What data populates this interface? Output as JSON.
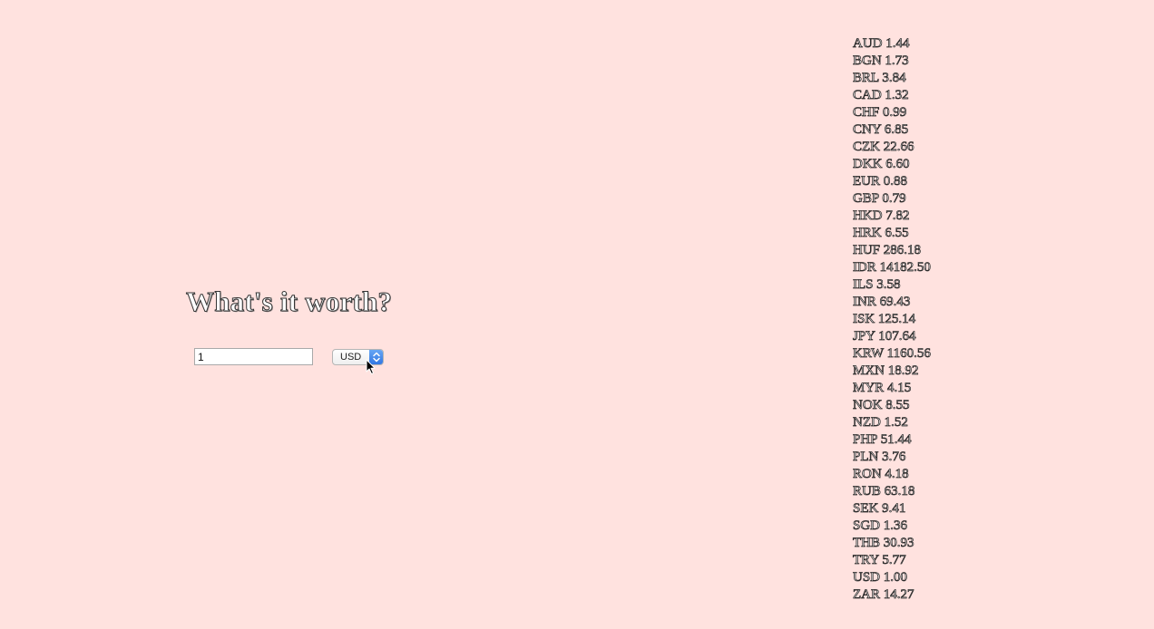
{
  "title": "What's it worth?",
  "amount_input": {
    "value": "1"
  },
  "currency_select": {
    "selected": "USD"
  },
  "rates": [
    {
      "code": "AUD",
      "rate": "1.44"
    },
    {
      "code": "BGN",
      "rate": "1.73"
    },
    {
      "code": "BRL",
      "rate": "3.84"
    },
    {
      "code": "CAD",
      "rate": "1.32"
    },
    {
      "code": "CHF",
      "rate": "0.99"
    },
    {
      "code": "CNY",
      "rate": "6.85"
    },
    {
      "code": "CZK",
      "rate": "22.66"
    },
    {
      "code": "DKK",
      "rate": "6.60"
    },
    {
      "code": "EUR",
      "rate": "0.88"
    },
    {
      "code": "GBP",
      "rate": "0.79"
    },
    {
      "code": "HKD",
      "rate": "7.82"
    },
    {
      "code": "HRK",
      "rate": "6.55"
    },
    {
      "code": "HUF",
      "rate": "286.18"
    },
    {
      "code": "IDR",
      "rate": "14182.50"
    },
    {
      "code": "ILS",
      "rate": "3.58"
    },
    {
      "code": "INR",
      "rate": "69.43"
    },
    {
      "code": "ISK",
      "rate": "125.14"
    },
    {
      "code": "JPY",
      "rate": "107.64"
    },
    {
      "code": "KRW",
      "rate": "1160.56"
    },
    {
      "code": "MXN",
      "rate": "18.92"
    },
    {
      "code": "MYR",
      "rate": "4.15"
    },
    {
      "code": "NOK",
      "rate": "8.55"
    },
    {
      "code": "NZD",
      "rate": "1.52"
    },
    {
      "code": "PHP",
      "rate": "51.44"
    },
    {
      "code": "PLN",
      "rate": "3.76"
    },
    {
      "code": "RON",
      "rate": "4.18"
    },
    {
      "code": "RUB",
      "rate": "63.18"
    },
    {
      "code": "SEK",
      "rate": "9.41"
    },
    {
      "code": "SGD",
      "rate": "1.36"
    },
    {
      "code": "THB",
      "rate": "30.93"
    },
    {
      "code": "TRY",
      "rate": "5.77"
    },
    {
      "code": "USD",
      "rate": "1.00"
    },
    {
      "code": "ZAR",
      "rate": "14.27"
    }
  ],
  "colors": {
    "background": "#ffe2df",
    "select_arrow": "#3b82f6"
  },
  "icons": {
    "select_arrow": "up-down-chevron-icon",
    "pointer": "mouse-pointer-icon"
  }
}
